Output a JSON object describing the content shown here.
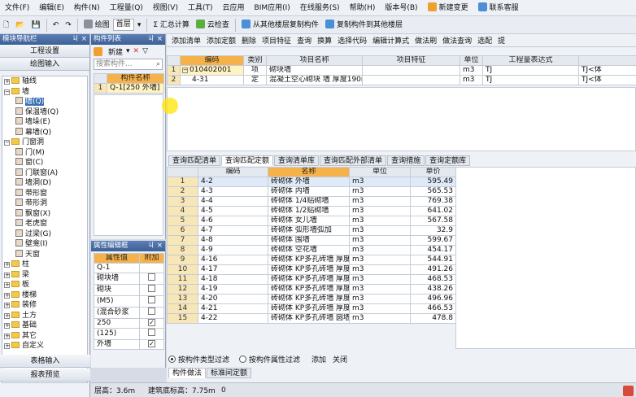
{
  "menu": [
    "文件(F)",
    "编辑(E)",
    "构件(N)",
    "工程量(Q)",
    "视图(V)",
    "工具(T)",
    "云应用",
    "BIM应用(I)",
    "在线服务(S)",
    "帮助(H)",
    "版本号(B)",
    "新建变更",
    "联系客服"
  ],
  "toolbar": {
    "draw": "绘图",
    "floor": "首层",
    "sum": "Σ 汇总计算",
    "cloud_check": "云检查",
    "copy_from_floor": "从其他楼层复制构件",
    "copy_to_floor": "复制构件到其他楼层"
  },
  "left_panel": {
    "title": "模块导航栏",
    "pin": "ㄐ ×",
    "nav_buttons": [
      "工程设置",
      "绘图输入"
    ],
    "tree": [
      {
        "label": "轴线",
        "level": 0,
        "type": "folder",
        "expander": "+"
      },
      {
        "label": "墙",
        "level": 0,
        "type": "folder",
        "expander": "−"
      },
      {
        "label": "墙(Q)",
        "level": 1,
        "type": "item",
        "selected": true
      },
      {
        "label": "保温墙(Q)",
        "level": 1,
        "type": "item"
      },
      {
        "label": "墙垛(E)",
        "level": 1,
        "type": "item"
      },
      {
        "label": "幕墙(Q)",
        "level": 1,
        "type": "item"
      },
      {
        "label": "门窗洞",
        "level": 0,
        "type": "folder",
        "expander": "−"
      },
      {
        "label": "门(M)",
        "level": 1,
        "type": "item"
      },
      {
        "label": "窗(C)",
        "level": 1,
        "type": "item"
      },
      {
        "label": "门联窗(A)",
        "level": 1,
        "type": "item"
      },
      {
        "label": "墙洞(D)",
        "level": 1,
        "type": "item"
      },
      {
        "label": "带形窗",
        "level": 1,
        "type": "item"
      },
      {
        "label": "带形洞",
        "level": 1,
        "type": "item"
      },
      {
        "label": "飘窗(X)",
        "level": 1,
        "type": "item"
      },
      {
        "label": "老虎窗",
        "level": 1,
        "type": "item"
      },
      {
        "label": "过梁(G)",
        "level": 1,
        "type": "item"
      },
      {
        "label": "壁龛(I)",
        "level": 1,
        "type": "item"
      },
      {
        "label": "天窗",
        "level": 1,
        "type": "item"
      },
      {
        "label": "柱",
        "level": 0,
        "type": "folder",
        "expander": "+"
      },
      {
        "label": "梁",
        "level": 0,
        "type": "folder",
        "expander": "+"
      },
      {
        "label": "板",
        "level": 0,
        "type": "folder",
        "expander": "+"
      },
      {
        "label": "楼梯",
        "level": 0,
        "type": "folder",
        "expander": "+"
      },
      {
        "label": "装修",
        "level": 0,
        "type": "folder",
        "expander": "+"
      },
      {
        "label": "土方",
        "level": 0,
        "type": "folder",
        "expander": "+"
      },
      {
        "label": "基础",
        "level": 0,
        "type": "folder",
        "expander": "+"
      },
      {
        "label": "其它",
        "level": 0,
        "type": "folder",
        "expander": "+"
      },
      {
        "label": "自定义",
        "level": 0,
        "type": "folder",
        "expander": "+"
      }
    ],
    "bottom_buttons": [
      "表格输入",
      "报表预览"
    ]
  },
  "component_list": {
    "title": "构件列表",
    "pin": "ㄐ ×",
    "new_button": "新建",
    "search_placeholder": "搜索构件...",
    "header": "构件名称",
    "rows": [
      {
        "index": "1",
        "name": "Q-1[250 外墙]"
      }
    ]
  },
  "property_panel": {
    "title": "属性编辑框",
    "pin": "ㄐ ×",
    "headers": [
      "属性值",
      "附加"
    ],
    "rows": [
      {
        "value": "Q-1",
        "checked": null
      },
      {
        "value": "砌块墙",
        "checked": false
      },
      {
        "value": "砌块",
        "checked": false
      },
      {
        "value": "(M5)",
        "checked": false
      },
      {
        "value": "(混合砂浆",
        "checked": false
      },
      {
        "value": "250",
        "checked": true
      },
      {
        "value": "(125)",
        "checked": false
      },
      {
        "value": "外墙",
        "checked": true
      }
    ]
  },
  "quantity_toolbar": [
    "添加清单",
    "添加定额",
    "删除",
    "项目特征",
    "查询",
    "换算",
    "选择代码",
    "编辑计算式",
    "做法刷",
    "做法查询",
    "选配",
    "提"
  ],
  "quantity_table": {
    "headers": [
      "",
      "编码",
      "类别",
      "项目名称",
      "项目特征",
      "单位",
      "工程量表达式",
      ""
    ],
    "rows": [
      {
        "index": "1",
        "expander": "−",
        "code": "010402001",
        "category": "项",
        "name": "砌块墙",
        "feature": "",
        "unit": "m3",
        "expr": "TJ",
        "extra": "TJ<体"
      },
      {
        "index": "2",
        "expander": "",
        "code": "4-31",
        "category": "定",
        "name": "混凝土空心砌块 墙 厚度190mm",
        "feature": "",
        "unit": "m3",
        "expr": "TJ",
        "extra": "TJ<体"
      }
    ]
  },
  "query_tabs": [
    "查询匹配清单",
    "查询匹配定额",
    "查询清单库",
    "查询匹配外部清单",
    "查询措施",
    "查询定额库"
  ],
  "query_table": {
    "headers": [
      "",
      "编码",
      "名称",
      "单位",
      "单价"
    ],
    "rows": [
      {
        "index": "1",
        "code": "4-2",
        "name": "砖砌体 外墙",
        "unit": "m3",
        "price": "595.49"
      },
      {
        "index": "2",
        "code": "4-3",
        "name": "砖砌体 内墙",
        "unit": "m3",
        "price": "565.53"
      },
      {
        "index": "3",
        "code": "4-4",
        "name": "砖砌体 1/4贴砌墙",
        "unit": "m3",
        "price": "769.38"
      },
      {
        "index": "4",
        "code": "4-5",
        "name": "砖砌体 1/2贴砌墙",
        "unit": "m3",
        "price": "641.02"
      },
      {
        "index": "5",
        "code": "4-6",
        "name": "砖砌体 女儿墙",
        "unit": "m3",
        "price": "567.58"
      },
      {
        "index": "6",
        "code": "4-7",
        "name": "砖砌体 弧形墙弧加",
        "unit": "m3",
        "price": "32.9"
      },
      {
        "index": "7",
        "code": "4-8",
        "name": "砖砌体 围墙",
        "unit": "m3",
        "price": "599.67"
      },
      {
        "index": "8",
        "code": "4-9",
        "name": "砖砌体 空花墙",
        "unit": "m3",
        "price": "454.17"
      },
      {
        "index": "9",
        "code": "4-16",
        "name": "砖砌体 KP多孔砖墙 厚度90mm",
        "unit": "m3",
        "price": "544.91"
      },
      {
        "index": "10",
        "code": "4-17",
        "name": "砖砌体 KP多孔砖墙 厚度140mm",
        "unit": "m3",
        "price": "491.26"
      },
      {
        "index": "11",
        "code": "4-18",
        "name": "砖砌体 KP多孔砖墙 厚度190mm",
        "unit": "m3",
        "price": "468.53"
      },
      {
        "index": "12",
        "code": "4-19",
        "name": "砖砌体 KP多孔砖墙 厚度240mm",
        "unit": "m3",
        "price": "438.26"
      },
      {
        "index": "13",
        "code": "4-20",
        "name": "砖砌体 KP多孔砖墙 厚度290mm",
        "unit": "m3",
        "price": "496.96"
      },
      {
        "index": "14",
        "code": "4-21",
        "name": "砖砌体 KP多孔砖墙 厚度340mm",
        "unit": "m3",
        "price": "466.53"
      },
      {
        "index": "15",
        "code": "4-22",
        "name": "砖砌体 KP多孔砖墙 圆墙",
        "unit": "m3",
        "price": "478.8"
      }
    ]
  },
  "filter": {
    "option1": "按构件类型过滤",
    "option2": "按构件属性过滤",
    "add": "添加",
    "close": "关闭"
  },
  "bottom_tabs": [
    "构件做法",
    "标准间定额"
  ],
  "status": {
    "floor_height": "层高：3.6m",
    "bottom_elev": "建筑底标高：7.75m",
    "zero": "0"
  },
  "colors": {
    "header_orange": "#f6b24a",
    "selected": "#3c6fb5",
    "rownum": "#f7e7b8"
  }
}
